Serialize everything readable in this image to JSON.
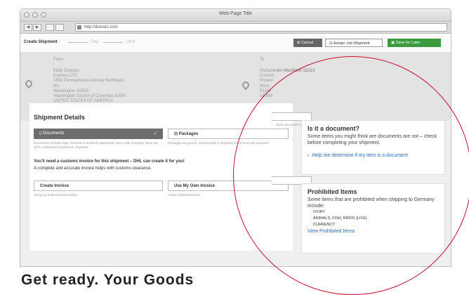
{
  "browser": {
    "title": "Web Page Title",
    "url": "http://domain.com",
    "back_glyph": "◀",
    "forward_glyph": "▶"
  },
  "steps": [
    "Create Shipment",
    "Pay",
    "Print"
  ],
  "actions": {
    "cancel": "Cancel",
    "assign": "Assign Job Shipment",
    "save": "Save for Later"
  },
  "from": {
    "label": "From",
    "lines": [
      "Eddy Express",
      "Express LTD",
      "1600 Pennsylvania Avenue Northwest",
      "NA",
      "Washington 20500",
      "Washington District of Columbia 20500",
      "UNITED STATES OF AMERICA"
    ]
  },
  "to": {
    "label": "To",
    "first_line": "Richards",
    "first_line_suffix": "ein-Westfalen 53113",
    "lines": [
      "Custom",
      "Rosent",
      "Bonn",
      "53113",
      "GERM"
    ]
  },
  "shipment": {
    "title": "Shipment Details",
    "documents_label": "Documents",
    "packages_label": "Packages",
    "documents_note": "Documents include legal, financial or business paperwork. Items with monetary value are NOT considered a document shipment.",
    "packages_note": "Packages are goods, merchandise or anything for commercial purposes.",
    "side_note": "ed for personal or",
    "invoice_heading": "You'll need a customs invoice for this shipment – DHL can create it for you!",
    "invoice_sub": "A complete and accurate invoice helps with customs clearance.",
    "create_invoice": "Create Invoice",
    "own_invoice": "Use My Own Invoice",
    "create_note": "Using my shipment information",
    "own_note": "I have a printed invoice"
  },
  "document_help": {
    "title": "Is it a document?",
    "body": "Some items you might think are documents are not – check before completing your shipment.",
    "link": "Help me determine if my item is a document"
  },
  "prohibited": {
    "title": "Prohibited Items",
    "body": "Some items that are prohibited when shipping to Germany include:",
    "items": [
      "IVORY",
      "ANIMALS, FISH, BIRDS (LIVE)",
      "CURRENCY"
    ],
    "link": "View Prohibited Items"
  },
  "page_heading": "Get ready. Your Goods"
}
